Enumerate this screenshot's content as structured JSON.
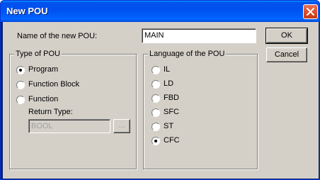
{
  "window": {
    "title": "New POU"
  },
  "name_field": {
    "label": "Name of the new POU:",
    "value": "MAIN"
  },
  "buttons": {
    "ok": "OK",
    "cancel": "Cancel",
    "browse": "..."
  },
  "type_group": {
    "title": "Type of POU",
    "options": [
      "Program",
      "Function Block",
      "Function"
    ],
    "selected": "Program",
    "return_type_label": "Return Type:",
    "return_type_value": "BOOL"
  },
  "language_group": {
    "title": "Language of the POU",
    "options": [
      "IL",
      "LD",
      "FBD",
      "SFC",
      "ST",
      "CFC"
    ],
    "selected": "CFC"
  },
  "colors": {
    "titlebar": "#0053ee",
    "dialog_bg": "#d4d0c8",
    "close_button": "#d9512e"
  },
  "icons": {
    "close": "close-icon"
  }
}
